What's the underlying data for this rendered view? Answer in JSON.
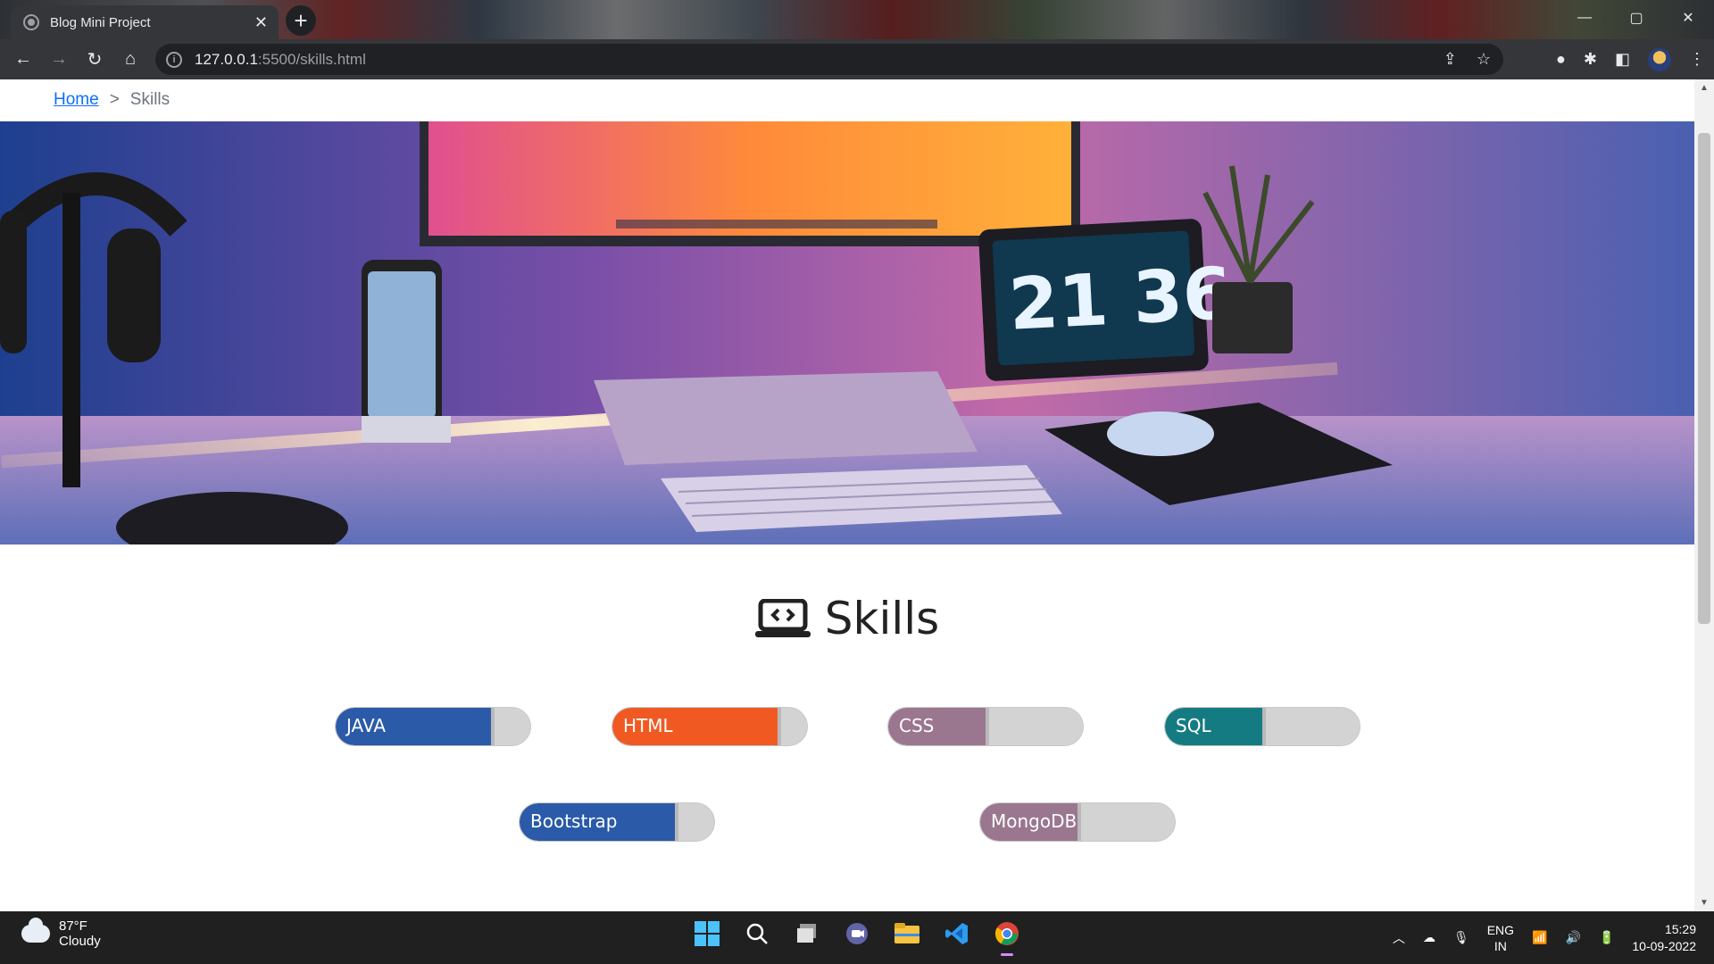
{
  "browser": {
    "tab_title": "Blog Mini Project",
    "tab_close": "✕",
    "new_tab": "+",
    "url_host": "127.0.0.1",
    "url_rest": ":5500/skills.html",
    "window_controls": [
      "—",
      "▢",
      "✕"
    ]
  },
  "breadcrumb": {
    "home": "Home",
    "separator": ">",
    "current": "Skills"
  },
  "hero": {
    "clock_text": "21 36"
  },
  "section": {
    "title": "Skills"
  },
  "skills": [
    {
      "name": "JAVA",
      "level": 0.8,
      "color": "#2a5aa8"
    },
    {
      "name": "HTML",
      "level": 0.85,
      "color": "#f05a22"
    },
    {
      "name": "CSS",
      "level": 0.5,
      "color": "#9a778f"
    },
    {
      "name": "SQL",
      "level": 0.5,
      "color": "#157b82"
    },
    {
      "name": "Bootstrap",
      "level": 0.8,
      "color": "#2a5aa8"
    },
    {
      "name": "MongoDB",
      "level": 0.5,
      "color": "#9a778f"
    }
  ],
  "taskbar": {
    "temperature": "87°F",
    "condition": "Cloudy",
    "lang_top": "ENG",
    "lang_bottom": "IN",
    "time": "15:29",
    "date": "10-09-2022"
  }
}
